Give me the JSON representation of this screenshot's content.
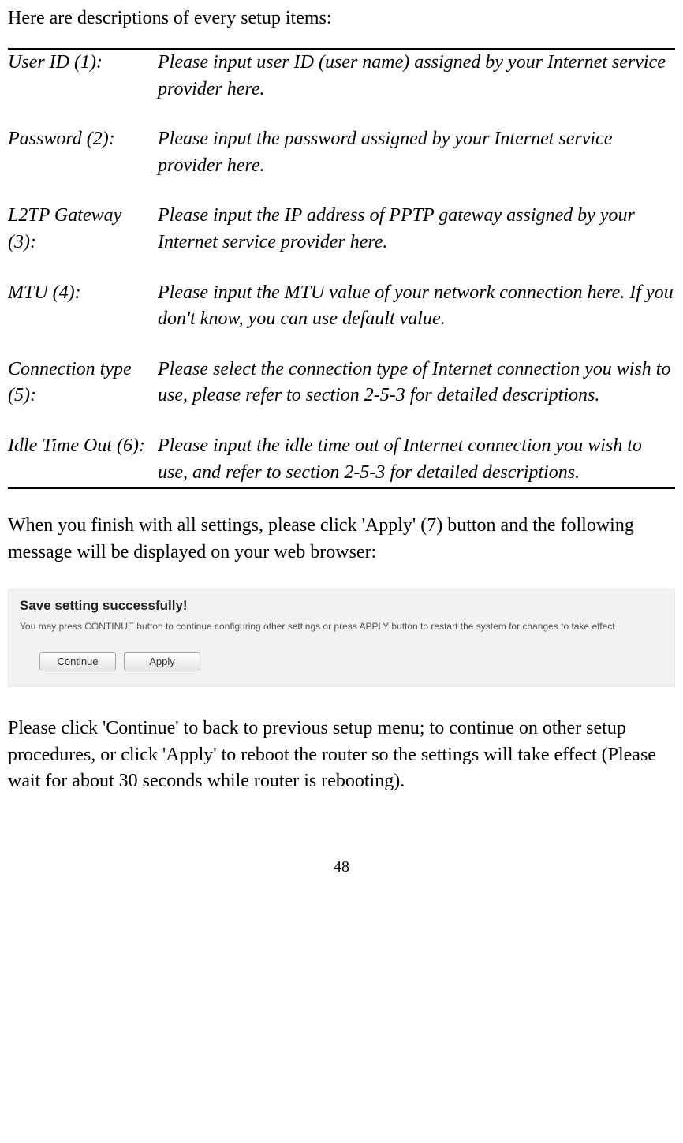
{
  "intro": "Here are descriptions of every setup items:",
  "rows": [
    {
      "label": "User ID (1):",
      "desc": "Please input user ID (user name) assigned by your Internet service provider here."
    },
    {
      "label": "Password (2):",
      "desc": "Please input the password assigned by your Internet service provider here."
    },
    {
      "label": "L2TP Gateway (3):",
      "desc": "Please input the IP address of PPTP gateway assigned by your Internet service provider here."
    },
    {
      "label": "MTU (4):",
      "desc": "Please input the MTU value of your network connection here. If you don't know, you can use default value."
    },
    {
      "label": "Connection type (5):",
      "desc": "Please select the connection type of Internet connection you wish to use, please refer to section 2-5-3 for detailed descriptions."
    },
    {
      "label": "Idle Time Out (6):",
      "desc": "Please input the idle time out of Internet connection you wish to use, and refer to section 2-5-3 for detailed descriptions."
    }
  ],
  "after_table": "When you finish with all settings, please click 'Apply' (7) button and the following message will be displayed on your web browser:",
  "dialog": {
    "title": "Save setting successfully!",
    "text": "You may press CONTINUE button to continue configuring other settings or press APPLY button to restart the system for changes to take effect",
    "continue_label": "Continue",
    "apply_label": "Apply"
  },
  "post_dialog": "Please click 'Continue' to back to previous setup menu; to continue on other setup procedures, or click 'Apply' to reboot the router so the settings will take effect (Please wait for about 30 seconds while router is rebooting).",
  "page_number": "48"
}
